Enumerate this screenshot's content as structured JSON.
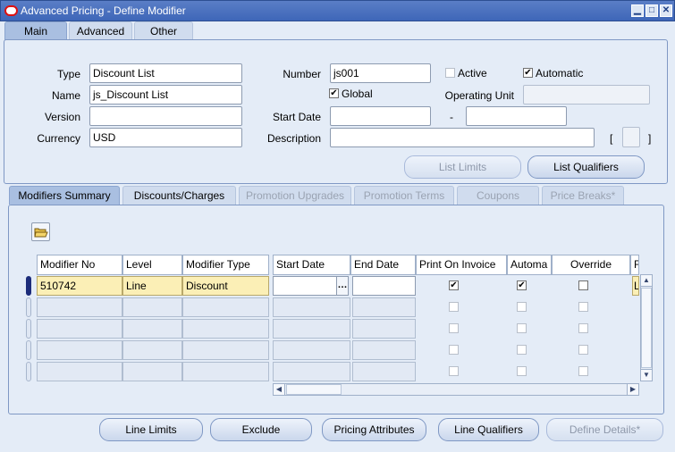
{
  "window": {
    "title": "Advanced Pricing - Define Modifier",
    "min": "▁",
    "max": "□",
    "close": "✕"
  },
  "top_tabs": [
    {
      "label": "Main"
    },
    {
      "label": "Advanced"
    },
    {
      "label": "Other"
    }
  ],
  "header": {
    "type_label": "Type",
    "type_value": "Discount List",
    "name_label": "Name",
    "name_value": "js_Discount List",
    "version_label": "Version",
    "version_value": "",
    "currency_label": "Currency",
    "currency_value": "USD",
    "number_label": "Number",
    "number_value": "js001",
    "global_label": "Global",
    "global_checked": "✔",
    "start_date_label": "Start Date",
    "start_date_value": "",
    "dash": "-",
    "end_date_value": "",
    "description_label": "Description",
    "description_value": "",
    "active_label": "Active",
    "active_checked": "",
    "automatic_label": "Automatic",
    "automatic_checked": "✔",
    "operating_unit_label": "Operating Unit",
    "operating_unit_value": "",
    "bracket_open": "[",
    "bracket_close": "]"
  },
  "header_buttons": {
    "list_limits": "List Limits",
    "list_qualifiers": "List Qualifiers"
  },
  "sub_tabs": [
    {
      "label": "Modifiers Summary"
    },
    {
      "label": "Discounts/Charges"
    },
    {
      "label": "Promotion Upgrades"
    },
    {
      "label": "Promotion Terms"
    },
    {
      "label": "Coupons"
    },
    {
      "label": "Price Breaks*"
    }
  ],
  "grid": {
    "columns": [
      "Modifier No",
      "Level",
      "Modifier Type",
      "Start Date",
      "End Date",
      "Print On Invoice",
      "Automa",
      "Override",
      "F"
    ],
    "rows": [
      {
        "modifier_no": "510742",
        "level": "Line",
        "modifier_type": "Discount",
        "start_date": "",
        "end_date": "",
        "print_on_invoice": "✔",
        "automatic": "✔",
        "override": "",
        "f": "L"
      },
      {
        "modifier_no": "",
        "level": "",
        "modifier_type": "",
        "start_date": "",
        "end_date": "",
        "print_on_invoice": "",
        "automatic": "",
        "override": "",
        "f": ""
      },
      {
        "modifier_no": "",
        "level": "",
        "modifier_type": "",
        "start_date": "",
        "end_date": "",
        "print_on_invoice": "",
        "automatic": "",
        "override": "",
        "f": ""
      },
      {
        "modifier_no": "",
        "level": "",
        "modifier_type": "",
        "start_date": "",
        "end_date": "",
        "print_on_invoice": "",
        "automatic": "",
        "override": "",
        "f": ""
      },
      {
        "modifier_no": "",
        "level": "",
        "modifier_type": "",
        "start_date": "",
        "end_date": "",
        "print_on_invoice": "",
        "automatic": "",
        "override": "",
        "f": ""
      }
    ],
    "date_picker_glyph": "…"
  },
  "footer_buttons": {
    "line_limits": "Line Limits",
    "exclude": "Exclude",
    "pricing_attributes": "Pricing Attributes",
    "line_qualifiers": "Line Qualifiers",
    "define_details": "Define Details*"
  },
  "icons": {
    "folder": "folder-icon"
  }
}
